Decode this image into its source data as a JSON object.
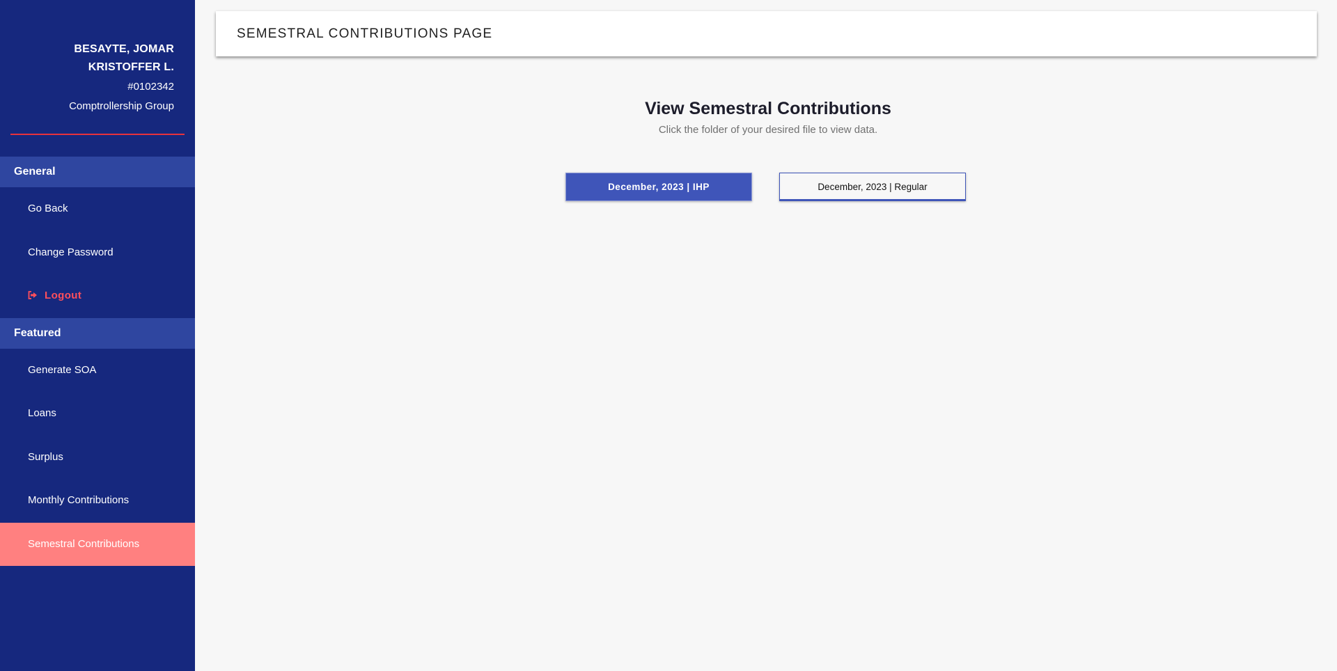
{
  "profile": {
    "name_line1": "BESAYTE, JOMAR",
    "name_line2": "KRISTOFFER L.",
    "id": "#0102342",
    "group": "Comptrollership Group"
  },
  "sidebar": {
    "general_header": "General",
    "general_items": [
      {
        "label": "Go Back"
      },
      {
        "label": "Change Password"
      },
      {
        "label": "Logout",
        "icon": "sign-out-icon"
      }
    ],
    "featured_header": "Featured",
    "featured_items": [
      {
        "label": "Generate SOA"
      },
      {
        "label": "Loans"
      },
      {
        "label": "Surplus"
      },
      {
        "label": "Monthly Contributions"
      },
      {
        "label": "Semestral Contributions",
        "active": true
      }
    ]
  },
  "header": {
    "title": "SEMESTRAL CONTRIBUTIONS PAGE"
  },
  "content": {
    "title": "View Semestral Contributions",
    "subtitle": "Click the folder of your desired file to view data.",
    "folders": [
      {
        "label": "December, 2023 | IHP",
        "selected": true
      },
      {
        "label": "December, 2023 | Regular",
        "selected": false
      }
    ]
  },
  "colors": {
    "sidebar_bg": "#16287e",
    "section_header_bg": "#2f46a0",
    "active_item_bg": "#ff8080",
    "accent_red": "#e8323c",
    "logout_text": "#ff4f5b",
    "primary_button": "#3f55b9"
  }
}
